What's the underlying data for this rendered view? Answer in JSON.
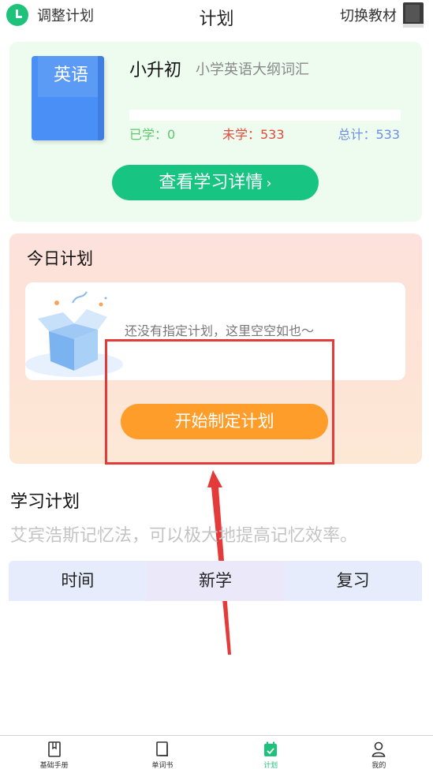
{
  "header": {
    "adjust_label": "调整计划",
    "title": "计划",
    "switch_label": "切换教材"
  },
  "book": {
    "cover_label": "英语",
    "grade": "小升初",
    "vocab_name": "小学英语大纲词汇",
    "learned_text": "已学：0",
    "unlearned_text": "未学：533",
    "total_text": "总计：533",
    "progress_fraction": 0,
    "detail_button": "查看学习详情",
    "detail_chevron": "›"
  },
  "today_plan": {
    "title": "今日计划",
    "empty_text": "还没有指定计划，这里空空如也～",
    "start_button": "开始制定计划"
  },
  "study_plan": {
    "title": "学习计划",
    "description": "艾宾浩斯记忆法，可以极大地提高记忆效率。",
    "columns": [
      "时间",
      "新学",
      "复习"
    ]
  },
  "nav": {
    "items": [
      {
        "label": "基础手册",
        "icon": "handbook-icon"
      },
      {
        "label": "单词书",
        "icon": "wordbook-icon"
      },
      {
        "label": "计划",
        "icon": "calendar-icon"
      },
      {
        "label": "我的",
        "icon": "profile-icon"
      }
    ],
    "active_index": 2
  },
  "colors": {
    "accent_green": "#1fc27a",
    "accent_orange": "#ff9d2b",
    "highlight_red": "#e43a3a"
  }
}
